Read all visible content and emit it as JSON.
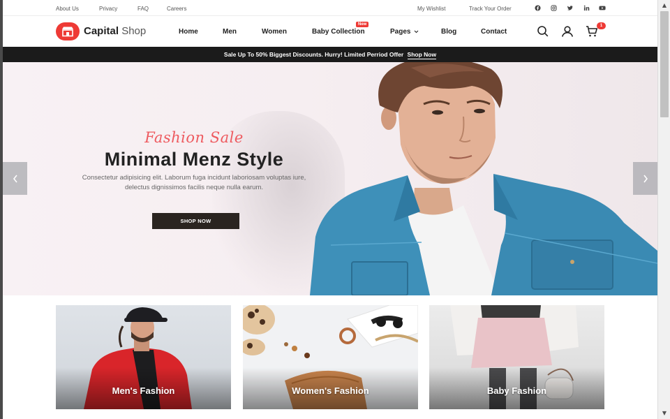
{
  "topbar": {
    "links": [
      "About Us",
      "Privacy",
      "FAQ",
      "Careers"
    ],
    "right_links": [
      "My Wishlist",
      "Track Your Order"
    ],
    "social_icons": [
      "facebook-icon",
      "instagram-icon",
      "twitter-icon",
      "linkedin-icon",
      "youtube-icon"
    ]
  },
  "header": {
    "brand_bold": "Capital",
    "brand_light": "Shop",
    "nav": [
      "Home",
      "Men",
      "Women",
      "Baby Collection",
      "Pages",
      "Blog",
      "Contact"
    ],
    "new_badge": "New",
    "cart_count": "1",
    "icons": [
      "search-icon",
      "user-icon",
      "cart-icon"
    ]
  },
  "promo": {
    "text": "Sale Up To 50% Biggest Discounts. Hurry! Limited Perriod Offer",
    "link": "Shop Now"
  },
  "hero": {
    "script": "Fashion Sale",
    "title": "Minimal Menz Style",
    "description": "Consectetur adipisicing elit. Laborum fuga incidunt laboriosam voluptas iure, delectus dignissimos facilis neque nulla earum.",
    "button": "SHOP NOW",
    "prev_arrow": "<",
    "next_arrow": ">"
  },
  "categories": [
    {
      "label": "Men's Fashion"
    },
    {
      "label": "Women's Fashion"
    },
    {
      "label": "Baby Fashion"
    }
  ],
  "colors": {
    "accent": "#ee3a35",
    "dark": "#1b1b1b",
    "denim": "#3d8fb8"
  }
}
